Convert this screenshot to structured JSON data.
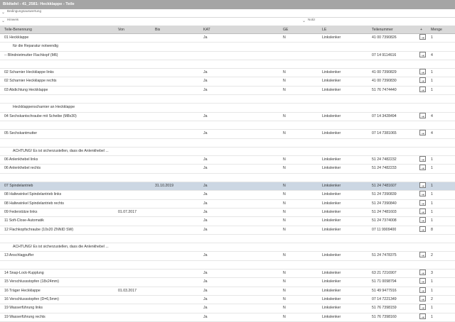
{
  "window": {
    "title": "Bildtafel - 41_2581: Heckklappe - Teile"
  },
  "expanders": {
    "usage_note": "Bedingungsauswertung",
    "hints": "Hinweis",
    "notes": "Notiz"
  },
  "columns": {
    "name": "Teile-Benennung",
    "von": "Von",
    "bis": "Bis",
    "kat": "KAT",
    "ge": "GE",
    "le": "LE",
    "teilenummer": "Teilenummer",
    "cart": "+",
    "menge": "Menge"
  },
  "rows": [
    {
      "name": "01 Heckklappe",
      "von": "",
      "bis": "",
      "kat": "Ja",
      "ge": "N",
      "le": "Linkslenker",
      "tn": "41 00 7390826",
      "menge": "1",
      "cart": true
    },
    {
      "name": "für die Reparatur notwendig",
      "sub": true
    },
    {
      "name": "-- Blindnietmutter Flachkopf (M6)",
      "von": "",
      "bis": "",
      "kat": "",
      "ge": "",
      "le": "",
      "tn": "07 14 9114616",
      "menge": "4",
      "cart": true
    },
    {
      "name": "",
      "gap": true
    },
    {
      "name": "02 Scharnier Heckklappe links",
      "kat": "Ja",
      "ge": "N",
      "le": "Linkslenker",
      "tn": "41 00 7390829",
      "menge": "1",
      "cart": true
    },
    {
      "name": "02 Scharnier Heckklappe rechts",
      "kat": "Ja",
      "ge": "N",
      "le": "Linkslenker",
      "tn": "41 00 7390830",
      "menge": "1",
      "cart": true
    },
    {
      "name": "03 Abdichtung Heckklappe",
      "kat": "Ja",
      "ge": "N",
      "le": "Linkslenker",
      "tn": "51 76 7474440",
      "menge": "1",
      "cart": true
    },
    {
      "name": "",
      "gap": true
    },
    {
      "name": "Heckklappenscharnier an Heckklappe",
      "sub": true
    },
    {
      "name": "04 Sechskantschraube mit Scheibe (M8x30)",
      "kat": "Ja",
      "ge": "N",
      "le": "Linkslenker",
      "tn": "07 14 3428494",
      "menge": "4",
      "cart": true
    },
    {
      "name": "",
      "gap": true
    },
    {
      "name": "05 Sechskantmutter",
      "kat": "Ja",
      "ge": "N",
      "le": "Linkslenker",
      "tn": "07 14 7381065",
      "menge": "4",
      "cart": true
    },
    {
      "name": "",
      "gap": true
    },
    {
      "name": "ACHTUNG! Es ist sicherzustellen, dass die Anlenkhebel ...",
      "sub": true
    },
    {
      "name": "06 Anlenkhebel links",
      "kat": "Ja",
      "ge": "N",
      "le": "Linkslenker",
      "tn": "51 24 7482232",
      "menge": "1",
      "cart": true
    },
    {
      "name": "06 Anlenkhebel rechts",
      "kat": "Ja",
      "ge": "N",
      "le": "Linkslenker",
      "tn": "51 24 7482233",
      "menge": "1",
      "cart": true
    },
    {
      "name": "",
      "gap": true
    },
    {
      "name": "07 Spindelantrieb",
      "bis": "31.10.2019",
      "kat": "Ja",
      "ge": "N",
      "le": "Linkslenker",
      "tn": "51 24 7481607",
      "menge": "1",
      "cart": true,
      "sel": true
    },
    {
      "name": "08 Haltewinkel Spindelantrieb links",
      "kat": "Ja",
      "ge": "N",
      "le": "Linkslenker",
      "tn": "51 24 7390839",
      "menge": "1",
      "cart": true
    },
    {
      "name": "08 Haltewinkel Spindelantrieb rechts",
      "kat": "Ja",
      "ge": "N",
      "le": "Linkslenker",
      "tn": "51 24 7390840",
      "menge": "1",
      "cart": true
    },
    {
      "name": "09 Federstütze links",
      "von": "01.07.2017",
      "kat": "Ja",
      "ge": "N",
      "le": "Linkslenker",
      "tn": "51 24 7481603",
      "menge": "1",
      "cart": true
    },
    {
      "name": "11 Soft-Close-Automatik",
      "kat": "Ja",
      "ge": "N",
      "le": "Linkslenker",
      "tn": "51 24 7374008",
      "menge": "1",
      "cart": true
    },
    {
      "name": "12 Flachkopfschraube (10x20 ZNNID SW)",
      "kat": "Ja",
      "ge": "N",
      "le": "Linkslenker",
      "tn": "07 11 9909400",
      "menge": "8",
      "cart": true
    },
    {
      "name": "",
      "gap": true
    },
    {
      "name": "ACHTUNG! Es ist sicherzustellen, dass die Anlenkhebel ...",
      "sub": true
    },
    {
      "name": "13 Anschlagpuffer",
      "kat": "Ja",
      "ge": "N",
      "le": "Linkslenker",
      "tn": "51 24 7478375",
      "menge": "2",
      "cart": true
    },
    {
      "name": "",
      "gap": true
    },
    {
      "name": "14 Snap-Lock-Kupplung",
      "kat": "Ja",
      "ge": "N",
      "le": "Linkslenker",
      "tn": "63 21 7216907",
      "menge": "3",
      "cart": true
    },
    {
      "name": "15 Verschlussstopfen (18x24mm)",
      "kat": "Ja",
      "ge": "N",
      "le": "Linkslenker",
      "tn": "51 71 0098794",
      "menge": "1",
      "cart": true
    },
    {
      "name": "16 Träger Heckklappe",
      "von": "01.03.2017",
      "kat": "Ja",
      "ge": "N",
      "le": "Linkslenker",
      "tn": "51 49 9477916",
      "menge": "1",
      "cart": true
    },
    {
      "name": "16 Verschlussstopfen (D=6,5mm)",
      "kat": "Ja",
      "ge": "N",
      "le": "Linkslenker",
      "tn": "07 14 7221349",
      "menge": "2",
      "cart": true
    },
    {
      "name": "19 Wasserführung links",
      "kat": "Ja",
      "ge": "N",
      "le": "Linkslenker",
      "tn": "51 76 7398159",
      "menge": "1",
      "cart": true
    },
    {
      "name": "19 Wasserführung rechts",
      "kat": "Ja",
      "ge": "N",
      "le": "Linkslenker",
      "tn": "51 76 7398160",
      "menge": "1",
      "cart": true
    }
  ]
}
